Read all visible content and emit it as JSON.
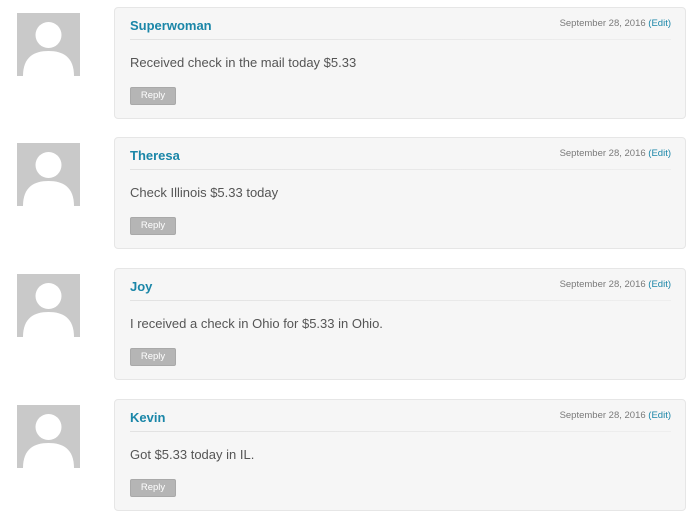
{
  "comments": [
    {
      "author": "Superwoman",
      "date": "September 28, 2016",
      "edit_label": "(Edit)",
      "text": "Received check in the mail today $5.33",
      "reply_label": "Reply",
      "avatar_icon": "default-user-silhouette-icon"
    },
    {
      "author": "Theresa",
      "date": "September 28, 2016",
      "edit_label": "(Edit)",
      "text": "Check Illinois $5.33 today",
      "reply_label": "Reply",
      "avatar_icon": "default-user-silhouette-icon"
    },
    {
      "author": "Joy",
      "date": "September 28, 2016",
      "edit_label": "(Edit)",
      "text": "I received a check in Ohio for $5.33 in Ohio.",
      "reply_label": "Reply",
      "avatar_icon": "default-user-silhouette-icon"
    },
    {
      "author": "Kevin",
      "date": "September 28, 2016",
      "edit_label": "(Edit)",
      "text": "Got $5.33 today in IL.",
      "reply_label": "Reply",
      "avatar_icon": "default-user-silhouette-icon"
    }
  ],
  "colors": {
    "author_link": "#1a86a8",
    "bubble_background": "#f6f6f6",
    "reply_button": "#b5b5b5",
    "avatar_background": "#c9c9c9"
  }
}
